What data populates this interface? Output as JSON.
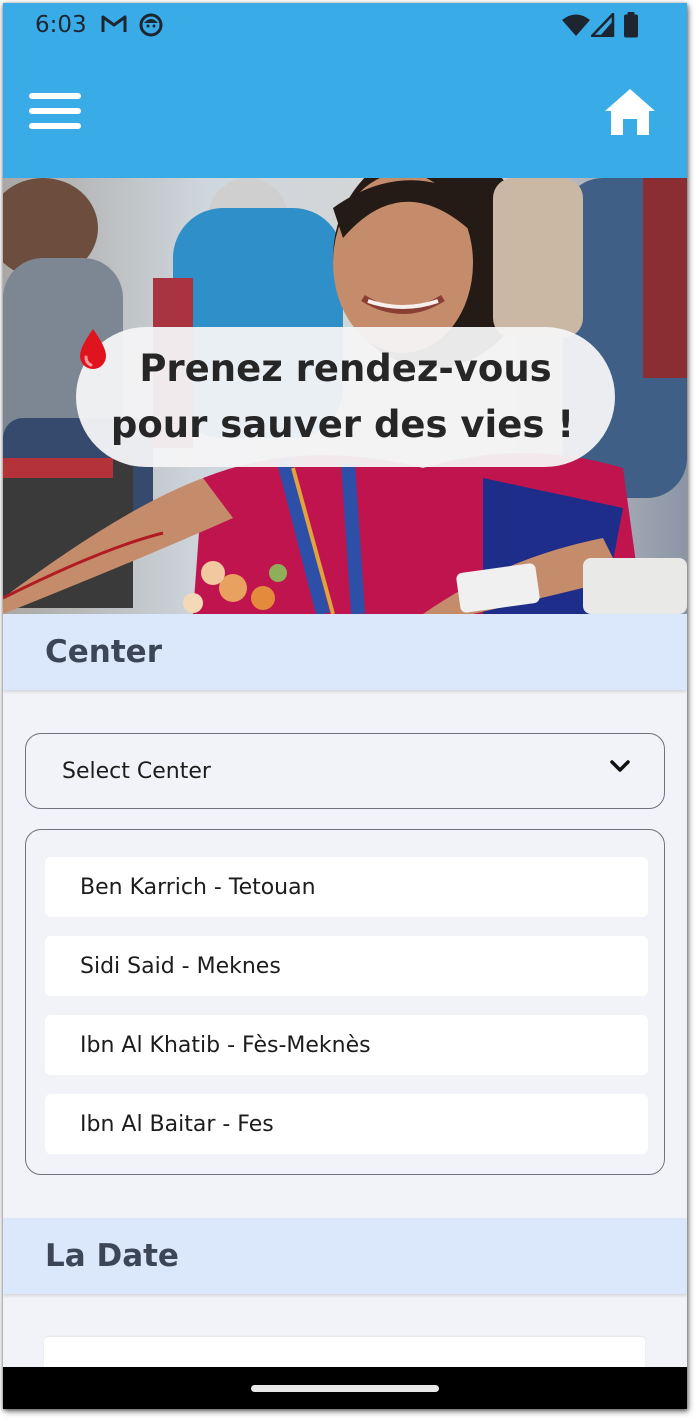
{
  "status_bar": {
    "time": "6:03",
    "icons": [
      "gmail-icon",
      "notification-face-icon",
      "wifi-icon",
      "signal-icon",
      "battery-icon"
    ]
  },
  "app_bar": {
    "menu_icon": "hamburger-menu-icon",
    "home_icon": "home-icon",
    "background_color": "#39ace7"
  },
  "hero": {
    "headline": "Prenez rendez-vous pour sauver des vies !",
    "icon": "blood-drop-icon"
  },
  "center_section": {
    "title": "Center",
    "select": {
      "value": "Select Center",
      "icon": "chevron-down-icon"
    },
    "options": [
      {
        "label": "Ben Karrich - Tetouan"
      },
      {
        "label": "Sidi Said - Meknes"
      },
      {
        "label": "Ibn Al Khatib - Fès-Meknès"
      },
      {
        "label": "Ibn Al Baitar - Fes"
      }
    ]
  },
  "date_section": {
    "title": "La Date"
  },
  "colors": {
    "primary": "#39ace7",
    "section_header_bg": "#dbe8fc",
    "page_bg": "#f2f3f8",
    "drop": "#e0141e"
  }
}
